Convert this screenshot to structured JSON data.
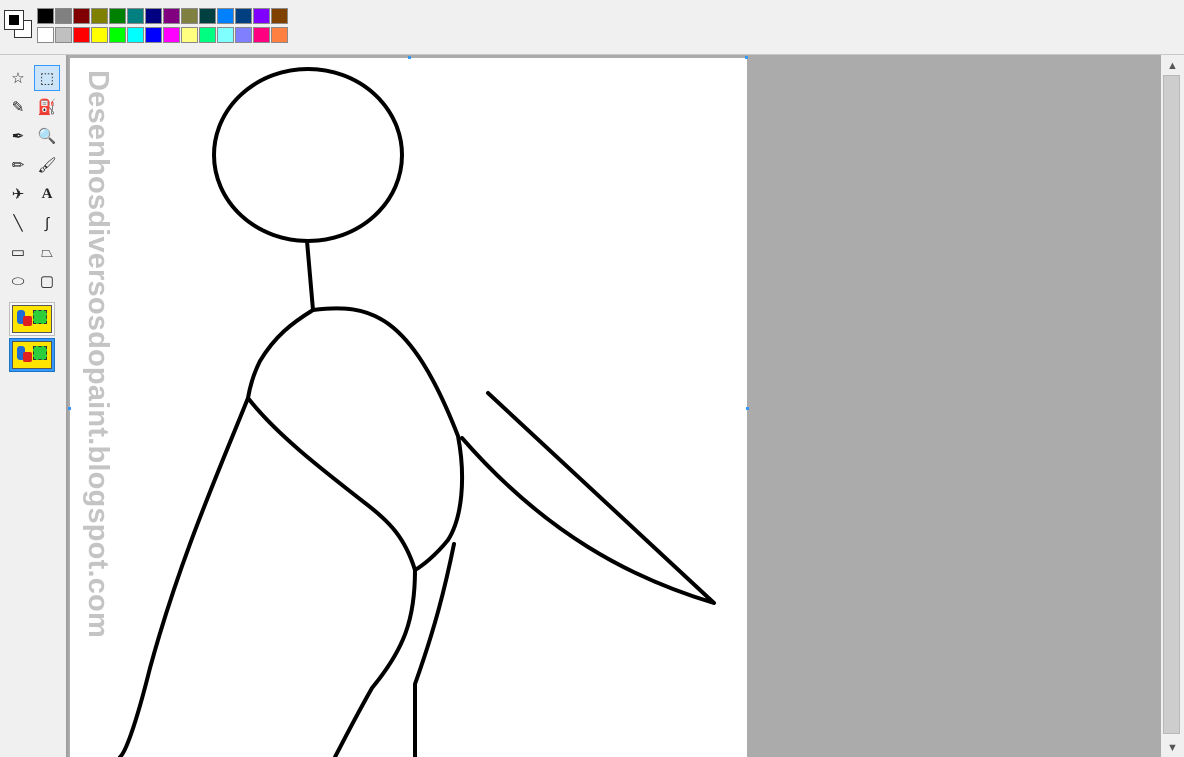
{
  "palette": {
    "row1": [
      "#000000",
      "#808080",
      "#800000",
      "#808000",
      "#008000",
      "#008080",
      "#000080",
      "#800080",
      "#808040",
      "#004040",
      "#0080ff",
      "#004080",
      "#8000ff",
      "#804000"
    ],
    "row2": [
      "#ffffff",
      "#c0c0c0",
      "#ff0000",
      "#ffff00",
      "#00ff00",
      "#00ffff",
      "#0000ff",
      "#ff00ff",
      "#ffff80",
      "#00ff80",
      "#80ffff",
      "#8080ff",
      "#ff0080",
      "#ff8040"
    ],
    "foreground": "#000000",
    "background": "#ffffff"
  },
  "tools": [
    {
      "name": "free-form-select",
      "glyph": "☆"
    },
    {
      "name": "rectangle-select",
      "glyph": "⬚",
      "selected": true
    },
    {
      "name": "eraser",
      "glyph": "✎"
    },
    {
      "name": "fill",
      "glyph": "⛽"
    },
    {
      "name": "color-picker",
      "glyph": "✒"
    },
    {
      "name": "magnifier",
      "glyph": "🔍"
    },
    {
      "name": "pencil",
      "glyph": "✏"
    },
    {
      "name": "brush",
      "glyph": "🖌"
    },
    {
      "name": "airbrush",
      "glyph": "✈"
    },
    {
      "name": "text",
      "glyph": "A"
    },
    {
      "name": "line",
      "glyph": "╲"
    },
    {
      "name": "curve",
      "glyph": "∫"
    },
    {
      "name": "rectangle",
      "glyph": "▭"
    },
    {
      "name": "polygon",
      "glyph": "⏢"
    },
    {
      "name": "ellipse",
      "glyph": "⬭"
    },
    {
      "name": "rounded-rectangle",
      "glyph": "▢"
    }
  ],
  "watermark": "Desenhosdiversosdopaint.blogspot.com",
  "scrollbar": {
    "up": "▲",
    "down": "▼"
  }
}
